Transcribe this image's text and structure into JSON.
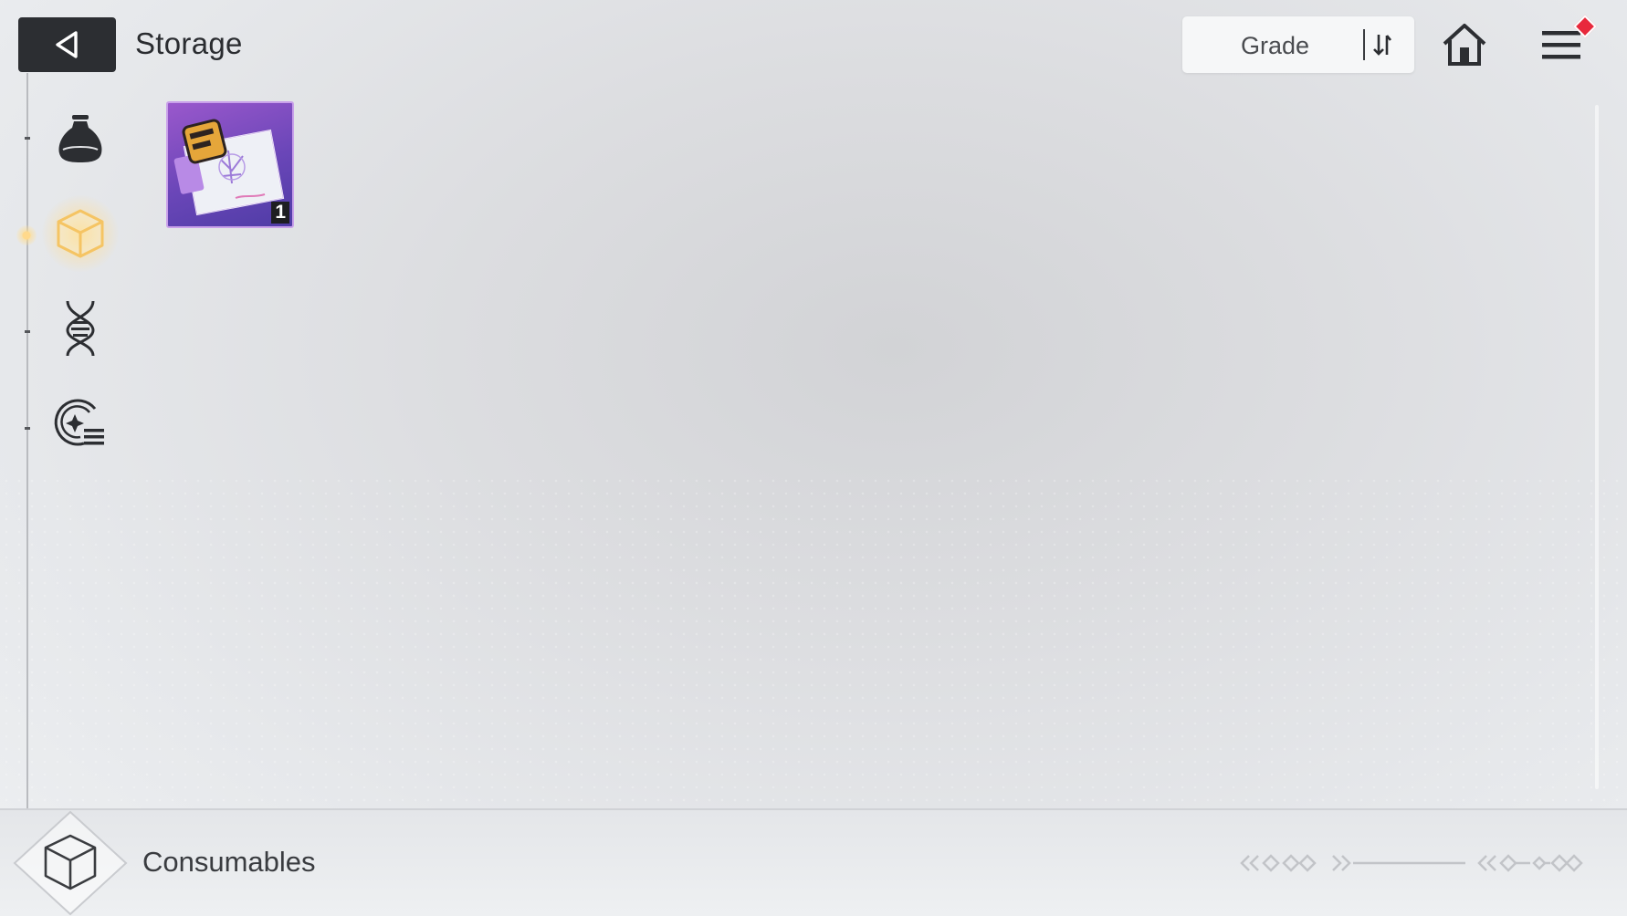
{
  "header": {
    "title": "Storage",
    "sort_label": "Grade"
  },
  "icons": {
    "back": "back-triangle-icon",
    "sort_toggle": "sort-order-icon",
    "home": "home-icon",
    "menu": "hamburger-menu-icon",
    "notification": "red-notification-dot"
  },
  "sidebar": {
    "items": [
      {
        "id": "materials",
        "icon": "pouch-icon",
        "active": false
      },
      {
        "id": "consumables",
        "icon": "cube-icon",
        "active": true
      },
      {
        "id": "genes",
        "icon": "dna-icon",
        "active": false
      },
      {
        "id": "cores",
        "icon": "core-list-icon",
        "active": false
      }
    ]
  },
  "items": [
    {
      "name": "ticket-item",
      "count": "1",
      "rarity_color": "#7a4ec0"
    }
  ],
  "footer": {
    "category": "Consumables"
  },
  "colors": {
    "accent_active": "#f5c463",
    "header_button": "#2c2e32",
    "notification": "#e8293c"
  }
}
